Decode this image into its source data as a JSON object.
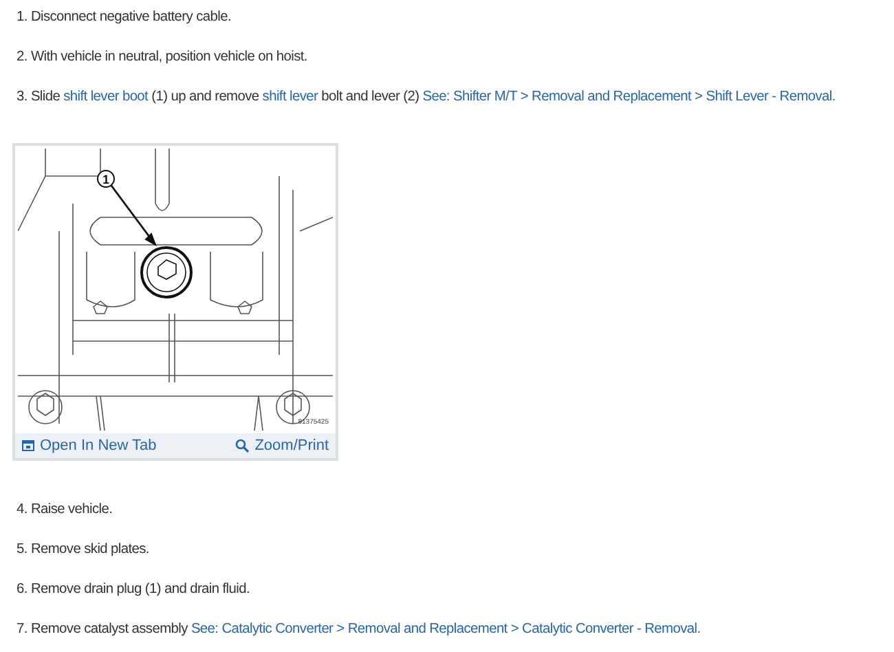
{
  "steps_before": [
    {
      "number": "1.",
      "parts": [
        {
          "kind": "text",
          "text": "Disconnect negative battery cable."
        }
      ]
    },
    {
      "number": "2.",
      "parts": [
        {
          "kind": "text",
          "text": "With vehicle in neutral, position vehicle on hoist."
        }
      ]
    },
    {
      "number": "3.",
      "parts": [
        {
          "kind": "text",
          "text": "Slide "
        },
        {
          "kind": "link",
          "text": "shift lever boot"
        },
        {
          "kind": "text",
          "text": " (1) up and remove "
        },
        {
          "kind": "link",
          "text": "shift lever"
        },
        {
          "kind": "text",
          "text": " bolt and lever (2) "
        },
        {
          "kind": "link",
          "text": "See: Shifter M/T > Removal and Replacement > Shift Lever - Removal."
        }
      ]
    }
  ],
  "figure": {
    "callout": "1",
    "code": "81375425",
    "open_link": "Open In New Tab",
    "zoom_link": "Zoom/Print"
  },
  "steps_after": [
    {
      "number": "4.",
      "parts": [
        {
          "kind": "text",
          "text": "Raise vehicle."
        }
      ]
    },
    {
      "number": "5.",
      "parts": [
        {
          "kind": "text",
          "text": "Remove skid plates."
        }
      ]
    },
    {
      "number": "6.",
      "parts": [
        {
          "kind": "text",
          "text": "Remove drain plug (1) and drain fluid."
        }
      ]
    },
    {
      "number": "7.",
      "parts": [
        {
          "kind": "text",
          "text": "Remove catalyst assembly "
        },
        {
          "kind": "link",
          "text": "See: Catalytic Converter > Removal and Replacement > Catalytic Converter - Removal."
        }
      ]
    }
  ]
}
